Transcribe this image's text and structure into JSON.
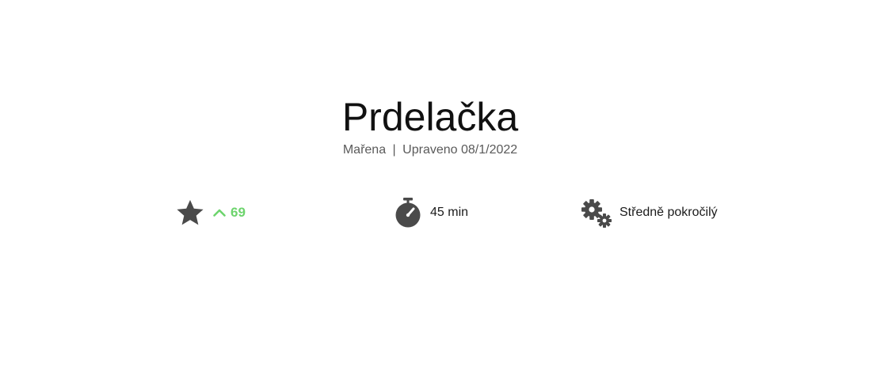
{
  "recipe": {
    "title": "Prdelačka",
    "author": "Mařena",
    "separator": "|",
    "updated": "Upraveno 08/1/2022"
  },
  "stats": {
    "rating": {
      "icon": "star-icon",
      "vote_icon": "chevron-up-icon",
      "count": "69",
      "count_color": "#6dd46d"
    },
    "time": {
      "icon": "stopwatch-icon",
      "label": "45 min"
    },
    "difficulty": {
      "icon": "gears-icon",
      "label": "Středně pokročilý"
    }
  },
  "colors": {
    "icon": "#4a4a4a",
    "accent": "#6dd46d",
    "meta_text": "#5a5a5a"
  }
}
